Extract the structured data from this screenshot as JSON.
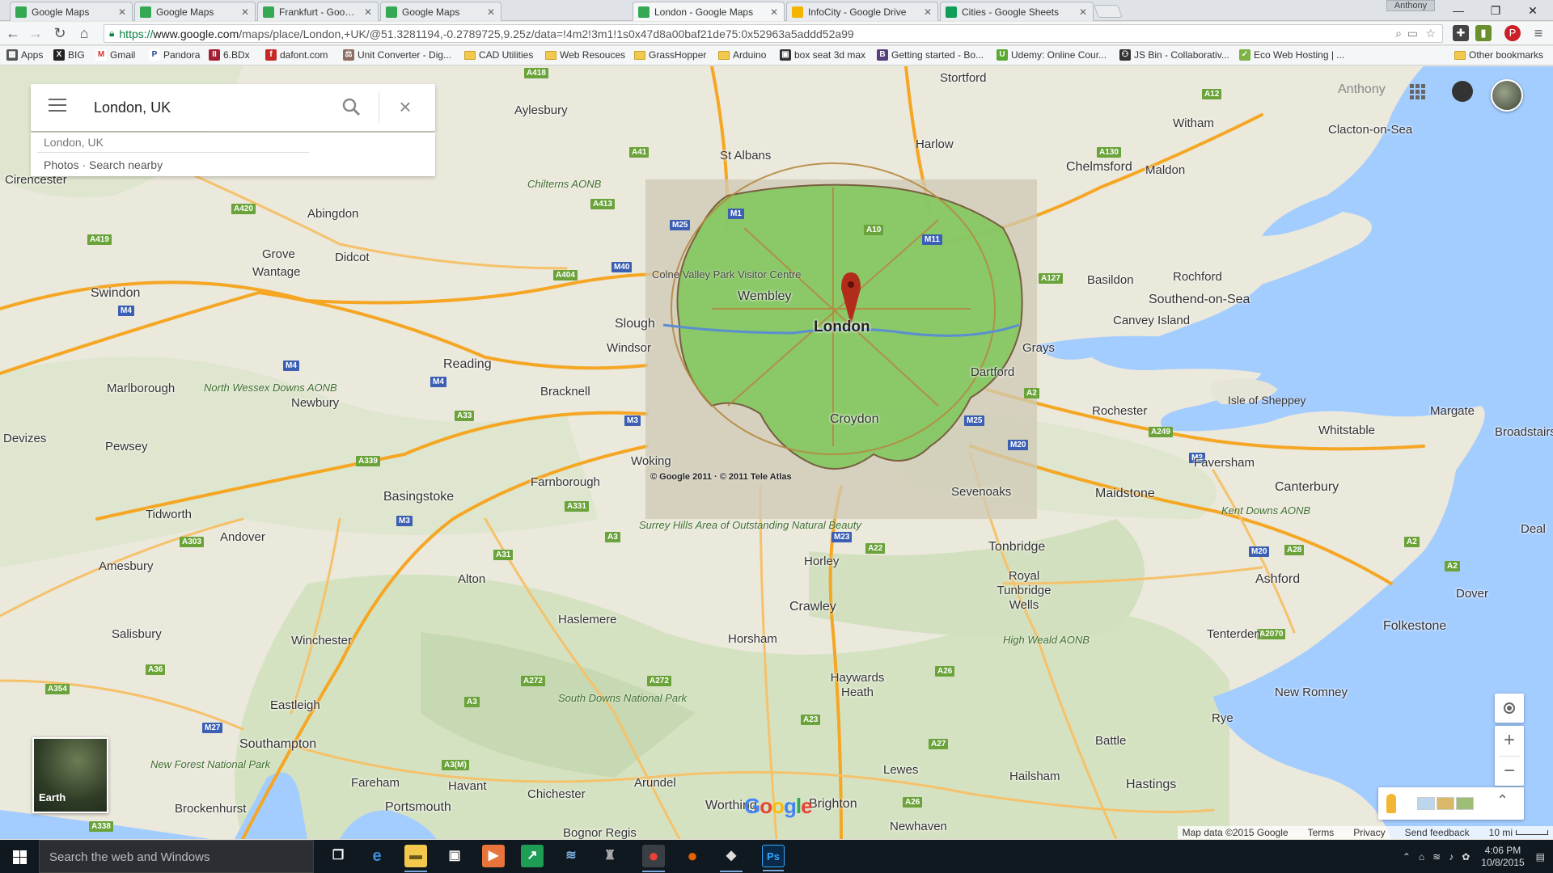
{
  "browser": {
    "tabs": [
      {
        "title": "Google Maps",
        "favicon_color": "#34a853",
        "active": false
      },
      {
        "title": "Google Maps",
        "favicon_color": "#34a853",
        "active": false
      },
      {
        "title": "Frankfurt - Google Maps",
        "favicon_color": "#34a853",
        "active": false
      },
      {
        "title": "Google Maps",
        "favicon_color": "#34a853",
        "active": false
      },
      {
        "title": "London - Google Maps",
        "favicon_color": "#34a853",
        "active": true
      },
      {
        "title": "InfoCity - Google Drive",
        "favicon_color": "#f4b400",
        "active": false
      },
      {
        "title": "Cities - Google Sheets",
        "favicon_color": "#0f9d58",
        "active": false
      }
    ],
    "profile_name": "Anthony",
    "url": {
      "scheme": "https://",
      "host": "www.google.com",
      "path": "/maps/place/London,+UK/@51.3281194,-0.2789725,9.25z/data=!4m2!3m1!1s0x47d8a00baf21de75:0x52963a5addd52a99"
    },
    "bookmarks": [
      {
        "label": "Apps",
        "icon": "apps-grid-icon",
        "color": "#555"
      },
      {
        "label": "BIG",
        "icon": "big-icon",
        "color": "#222"
      },
      {
        "label": "Gmail",
        "icon": "gmail-icon",
        "color": "#d93025"
      },
      {
        "label": "Pandora",
        "icon": "pandora-icon",
        "color": "#224099"
      },
      {
        "label": "6.BDx",
        "icon": "mit-icon",
        "color": "#a31f34"
      },
      {
        "label": "dafont.com",
        "icon": "dafont-icon",
        "color": "#c62828"
      },
      {
        "label": "Unit Converter - Dig...",
        "icon": "converter-icon",
        "color": "#8d6e63"
      },
      {
        "label": "CAD Utilities",
        "icon": "folder-icon",
        "color": "#f2c94c"
      },
      {
        "label": "Web Resouces",
        "icon": "folder-icon",
        "color": "#f2c94c"
      },
      {
        "label": "GrassHopper",
        "icon": "folder-icon",
        "color": "#f2c94c"
      },
      {
        "label": "Arduino",
        "icon": "folder-icon",
        "color": "#f2c94c"
      },
      {
        "label": "box seat 3d max",
        "icon": "box-icon",
        "color": "#333"
      },
      {
        "label": "Getting started - Bo...",
        "icon": "bootstrap-icon",
        "color": "#563d7c"
      },
      {
        "label": "Udemy: Online Cour...",
        "icon": "udemy-icon",
        "color": "#5aa832"
      },
      {
        "label": "JS Bin - Collaborativ...",
        "icon": "jsbin-icon",
        "color": "#333"
      },
      {
        "label": "Eco Web Hosting | ...",
        "icon": "eco-icon",
        "color": "#7cb342"
      }
    ],
    "other_bookmarks": "Other bookmarks"
  },
  "maps": {
    "search_value": "London, UK",
    "suggestion": "London, UK",
    "suggestion_links": "Photos · Search nearby",
    "user_name": "Anthony",
    "earth_label": "Earth",
    "overlay_credit": "© Google 2011 · © 2011 Tele Atlas",
    "logo_text": "Google",
    "attribution": {
      "data": "Map data ©2015 Google",
      "terms": "Terms",
      "privacy": "Privacy",
      "feedback": "Send feedback",
      "scale": "10 mi"
    },
    "places_big": [
      "London",
      "Croydon",
      "Reading",
      "Chelmsford",
      "Southend-on-Sea",
      "Crawley",
      "Brighton",
      "Southampton",
      "Portsmouth",
      "Canterbury"
    ],
    "places": [
      "Aylesbury",
      "St Albans",
      "Harlow",
      "Stortford",
      "Witham",
      "Clacton-on-Sea",
      "Maldon",
      "Abingdon",
      "Didcot",
      "Grove",
      "Wantage",
      "Swindon",
      "Wembley",
      "Basildon",
      "Rochford",
      "Canvey Island",
      "Slough",
      "Windsor",
      "Grays",
      "Dartford",
      "Bracknell",
      "Newbury",
      "Marlborough",
      "Rochester",
      "Isle of Sheppey",
      "Margate",
      "Whitstable",
      "Broadstairs",
      "Devizes",
      "Pewsey",
      "Woking",
      "Farnborough",
      "Basingstoke",
      "Sevenoaks",
      "Maidstone",
      "Faversham",
      "Tidworth",
      "Andover",
      "Amesbury",
      "Deal",
      "Tonbridge",
      "Royal Tunbridge Wells",
      "Ashford",
      "Dover",
      "Alton",
      "Horley",
      "Salisbury",
      "Haslemere",
      "Folkestone",
      "Winchester",
      "Horsham",
      "Tenterden",
      "Haywards Heath",
      "New Romney",
      "Eastleigh",
      "Rye",
      "Battle",
      "Lewes",
      "Hailsham",
      "Fareham",
      "Havant",
      "Chichester",
      "Arundel",
      "Hastings",
      "Worthing",
      "Newhaven",
      "Bognor Regis",
      "Brockenhurst",
      "Cirencester"
    ],
    "parks": [
      "Chilterns AONB",
      "North Wessex Downs AONB",
      "Surrey Hills Area of Outstanding Natural Beauty",
      "Kent Downs AONB",
      "High Weald AONB",
      "South Downs National Park",
      "New Forest National Park",
      "Colne Valley Park Visitor Centre"
    ],
    "roads": [
      "A418",
      "A41",
      "A413",
      "A420",
      "A419",
      "M25",
      "M1",
      "M11",
      "A10",
      "M40",
      "A404",
      "A127",
      "A12",
      "A130",
      "M4",
      "A33",
      "A339",
      "M3",
      "A331",
      "A3",
      "A31",
      "M23",
      "A22",
      "M25",
      "M20",
      "A2",
      "A249",
      "M2",
      "A28",
      "A2070",
      "A303",
      "A36",
      "A354",
      "M27",
      "A3(M)",
      "A338",
      "A272",
      "A23",
      "A26",
      "A27"
    ]
  },
  "taskbar": {
    "search_placeholder": "Search the web and Windows",
    "time": "4:06 PM",
    "date": "10/8/2015",
    "apps": [
      {
        "name": "task-view-icon",
        "color": "#101820",
        "glyph": "❐"
      },
      {
        "name": "edge-icon",
        "color": "#101820",
        "glyph": "e"
      },
      {
        "name": "file-explorer-icon",
        "color": "#f2c94c",
        "glyph": "▬"
      },
      {
        "name": "store-icon",
        "color": "#101820",
        "glyph": "▣"
      },
      {
        "name": "media-player-icon",
        "color": "#e8743b",
        "glyph": "▶"
      },
      {
        "name": "stock-app-icon",
        "color": "#1f9d55",
        "glyph": "↗"
      },
      {
        "name": "network-app-icon",
        "color": "#101820",
        "glyph": "≋"
      },
      {
        "name": "game-icon",
        "color": "#101820",
        "glyph": "♜"
      },
      {
        "name": "chrome-icon",
        "color": "#dd4b39",
        "glyph": "●"
      },
      {
        "name": "firefox-icon",
        "color": "#e66000",
        "glyph": "●"
      },
      {
        "name": "inkscape-icon",
        "color": "#101820",
        "glyph": "◆"
      },
      {
        "name": "photoshop-icon",
        "color": "#0b2a4a",
        "glyph": "Ps"
      }
    ]
  }
}
